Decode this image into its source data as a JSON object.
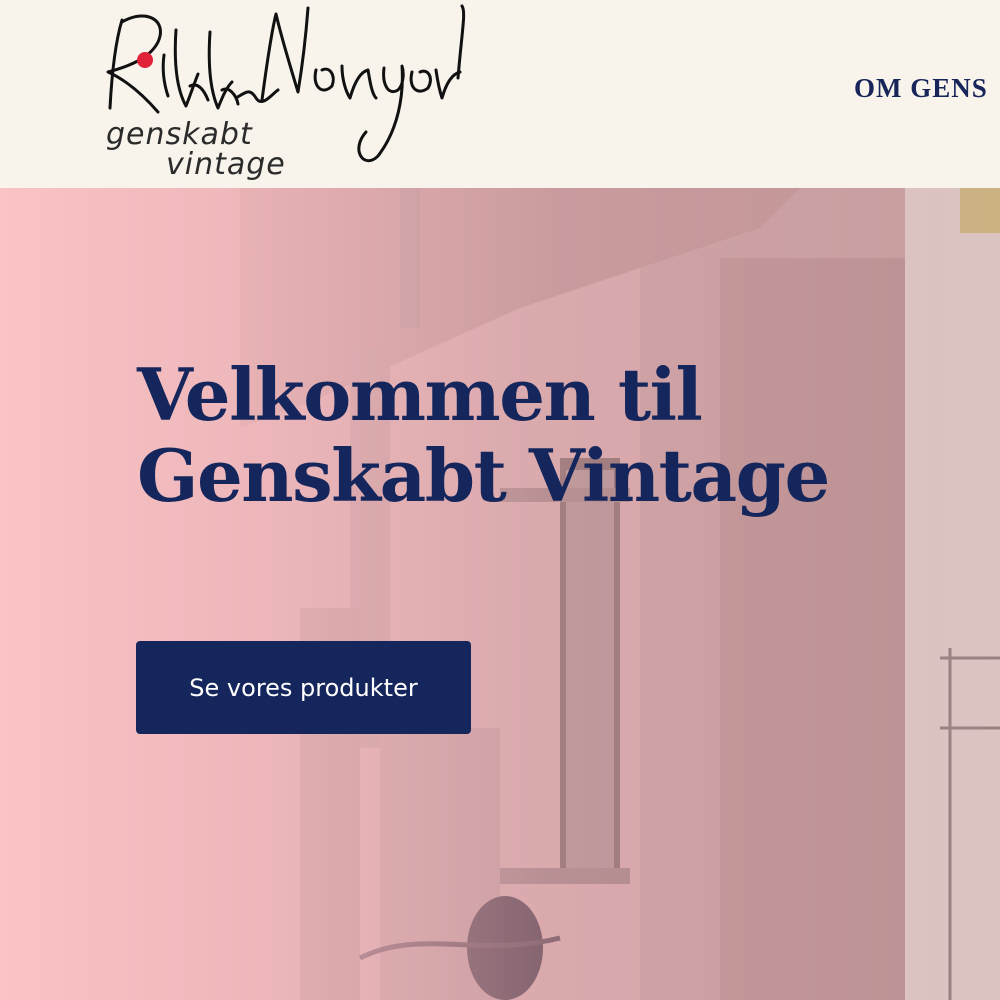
{
  "header": {
    "logo": {
      "signature": "Rikke Nørgaard",
      "line1": "genskabt",
      "line2": "vintage",
      "accent_color": "#e0233a"
    },
    "nav": {
      "item_1": "OM GENS"
    }
  },
  "hero": {
    "title_line1": "Velkommen til",
    "title_line2": "Genskabt Vintage",
    "cta_label": "Se vores produkter"
  },
  "colors": {
    "header_bg": "#f8f4ec",
    "navy": "#15265c",
    "hero_pink": "#fbc4c6"
  }
}
